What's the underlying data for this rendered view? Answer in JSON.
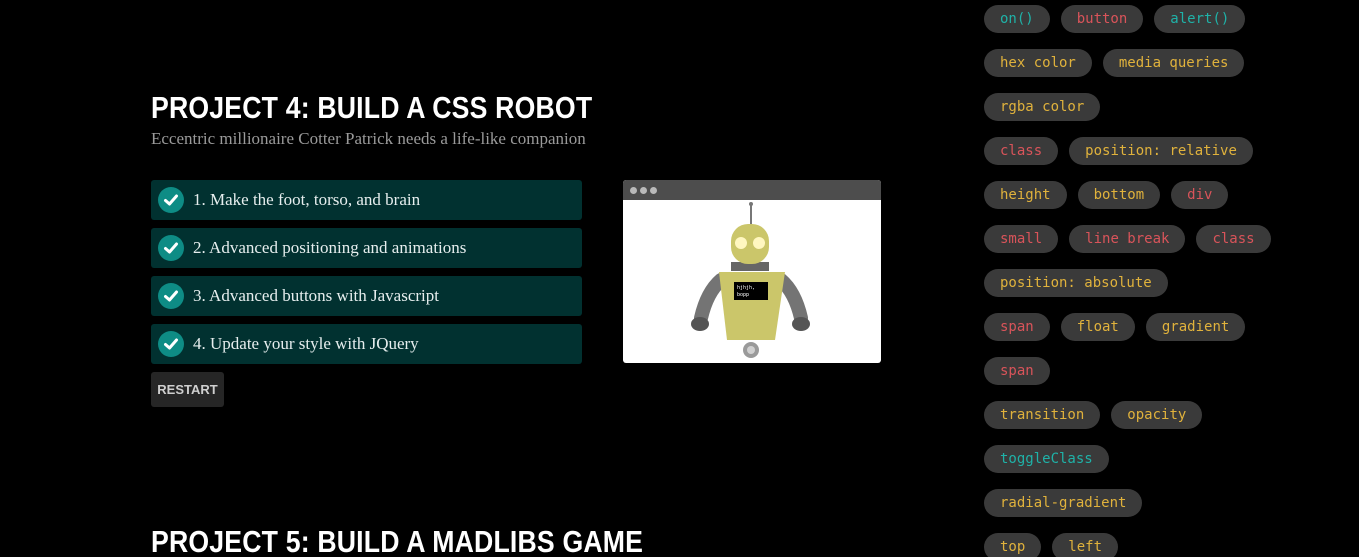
{
  "colors": {
    "background": "#000000",
    "step_bg": "#013130",
    "check_teal": "#0e8c85",
    "tag_bg": "#3a3a3a",
    "tag_teal": "#1fb2a8",
    "tag_red": "#d9545a",
    "tag_yellow": "#e0b23c"
  },
  "project4": {
    "title": "PROJECT 4: BUILD A CSS ROBOT",
    "subtitle": "Eccentric millionaire Cotter Patrick needs a life-like companion",
    "steps": [
      {
        "label": "1. Make the foot, torso, and brain",
        "icon": "check-icon"
      },
      {
        "label": "2. Advanced positioning and animations",
        "icon": "check-icon"
      },
      {
        "label": "3. Advanced buttons with Javascript",
        "icon": "check-icon"
      },
      {
        "label": "4. Update your style with JQuery",
        "icon": "check-icon"
      }
    ],
    "restart_label": "RESTART",
    "preview": {
      "robot_text_line1": "hjhjh,",
      "robot_text_line2": "bopp"
    }
  },
  "project5": {
    "title": "PROJECT 5: BUILD A MADLIBS GAME"
  },
  "tag_rows": [
    [
      {
        "text": "on()",
        "color": "teal"
      },
      {
        "text": "button",
        "color": "red"
      },
      {
        "text": "alert()",
        "color": "teal"
      }
    ],
    [
      {
        "text": "hex color",
        "color": "yellow"
      },
      {
        "text": "media queries",
        "color": "yellow"
      }
    ],
    [
      {
        "text": "rgba color",
        "color": "yellow"
      }
    ],
    [
      {
        "text": "class",
        "color": "red"
      },
      {
        "text": "position: relative",
        "color": "yellow"
      }
    ],
    [
      {
        "text": "height",
        "color": "yellow"
      },
      {
        "text": "bottom",
        "color": "yellow"
      },
      {
        "text": "div",
        "color": "red"
      }
    ],
    [
      {
        "text": "small",
        "color": "red"
      },
      {
        "text": "line break",
        "color": "red"
      },
      {
        "text": "class",
        "color": "red"
      }
    ],
    [
      {
        "text": "position: absolute",
        "color": "yellow"
      }
    ],
    [
      {
        "text": "span",
        "color": "red"
      },
      {
        "text": "float",
        "color": "yellow"
      },
      {
        "text": "gradient",
        "color": "yellow"
      }
    ],
    [
      {
        "text": "span",
        "color": "red"
      }
    ],
    [
      {
        "text": "transition",
        "color": "yellow"
      },
      {
        "text": "opacity",
        "color": "yellow"
      }
    ],
    [
      {
        "text": "toggleClass",
        "color": "teal"
      }
    ],
    [
      {
        "text": "radial-gradient",
        "color": "yellow"
      }
    ],
    [
      {
        "text": "top",
        "color": "yellow"
      },
      {
        "text": "left",
        "color": "yellow"
      }
    ]
  ]
}
